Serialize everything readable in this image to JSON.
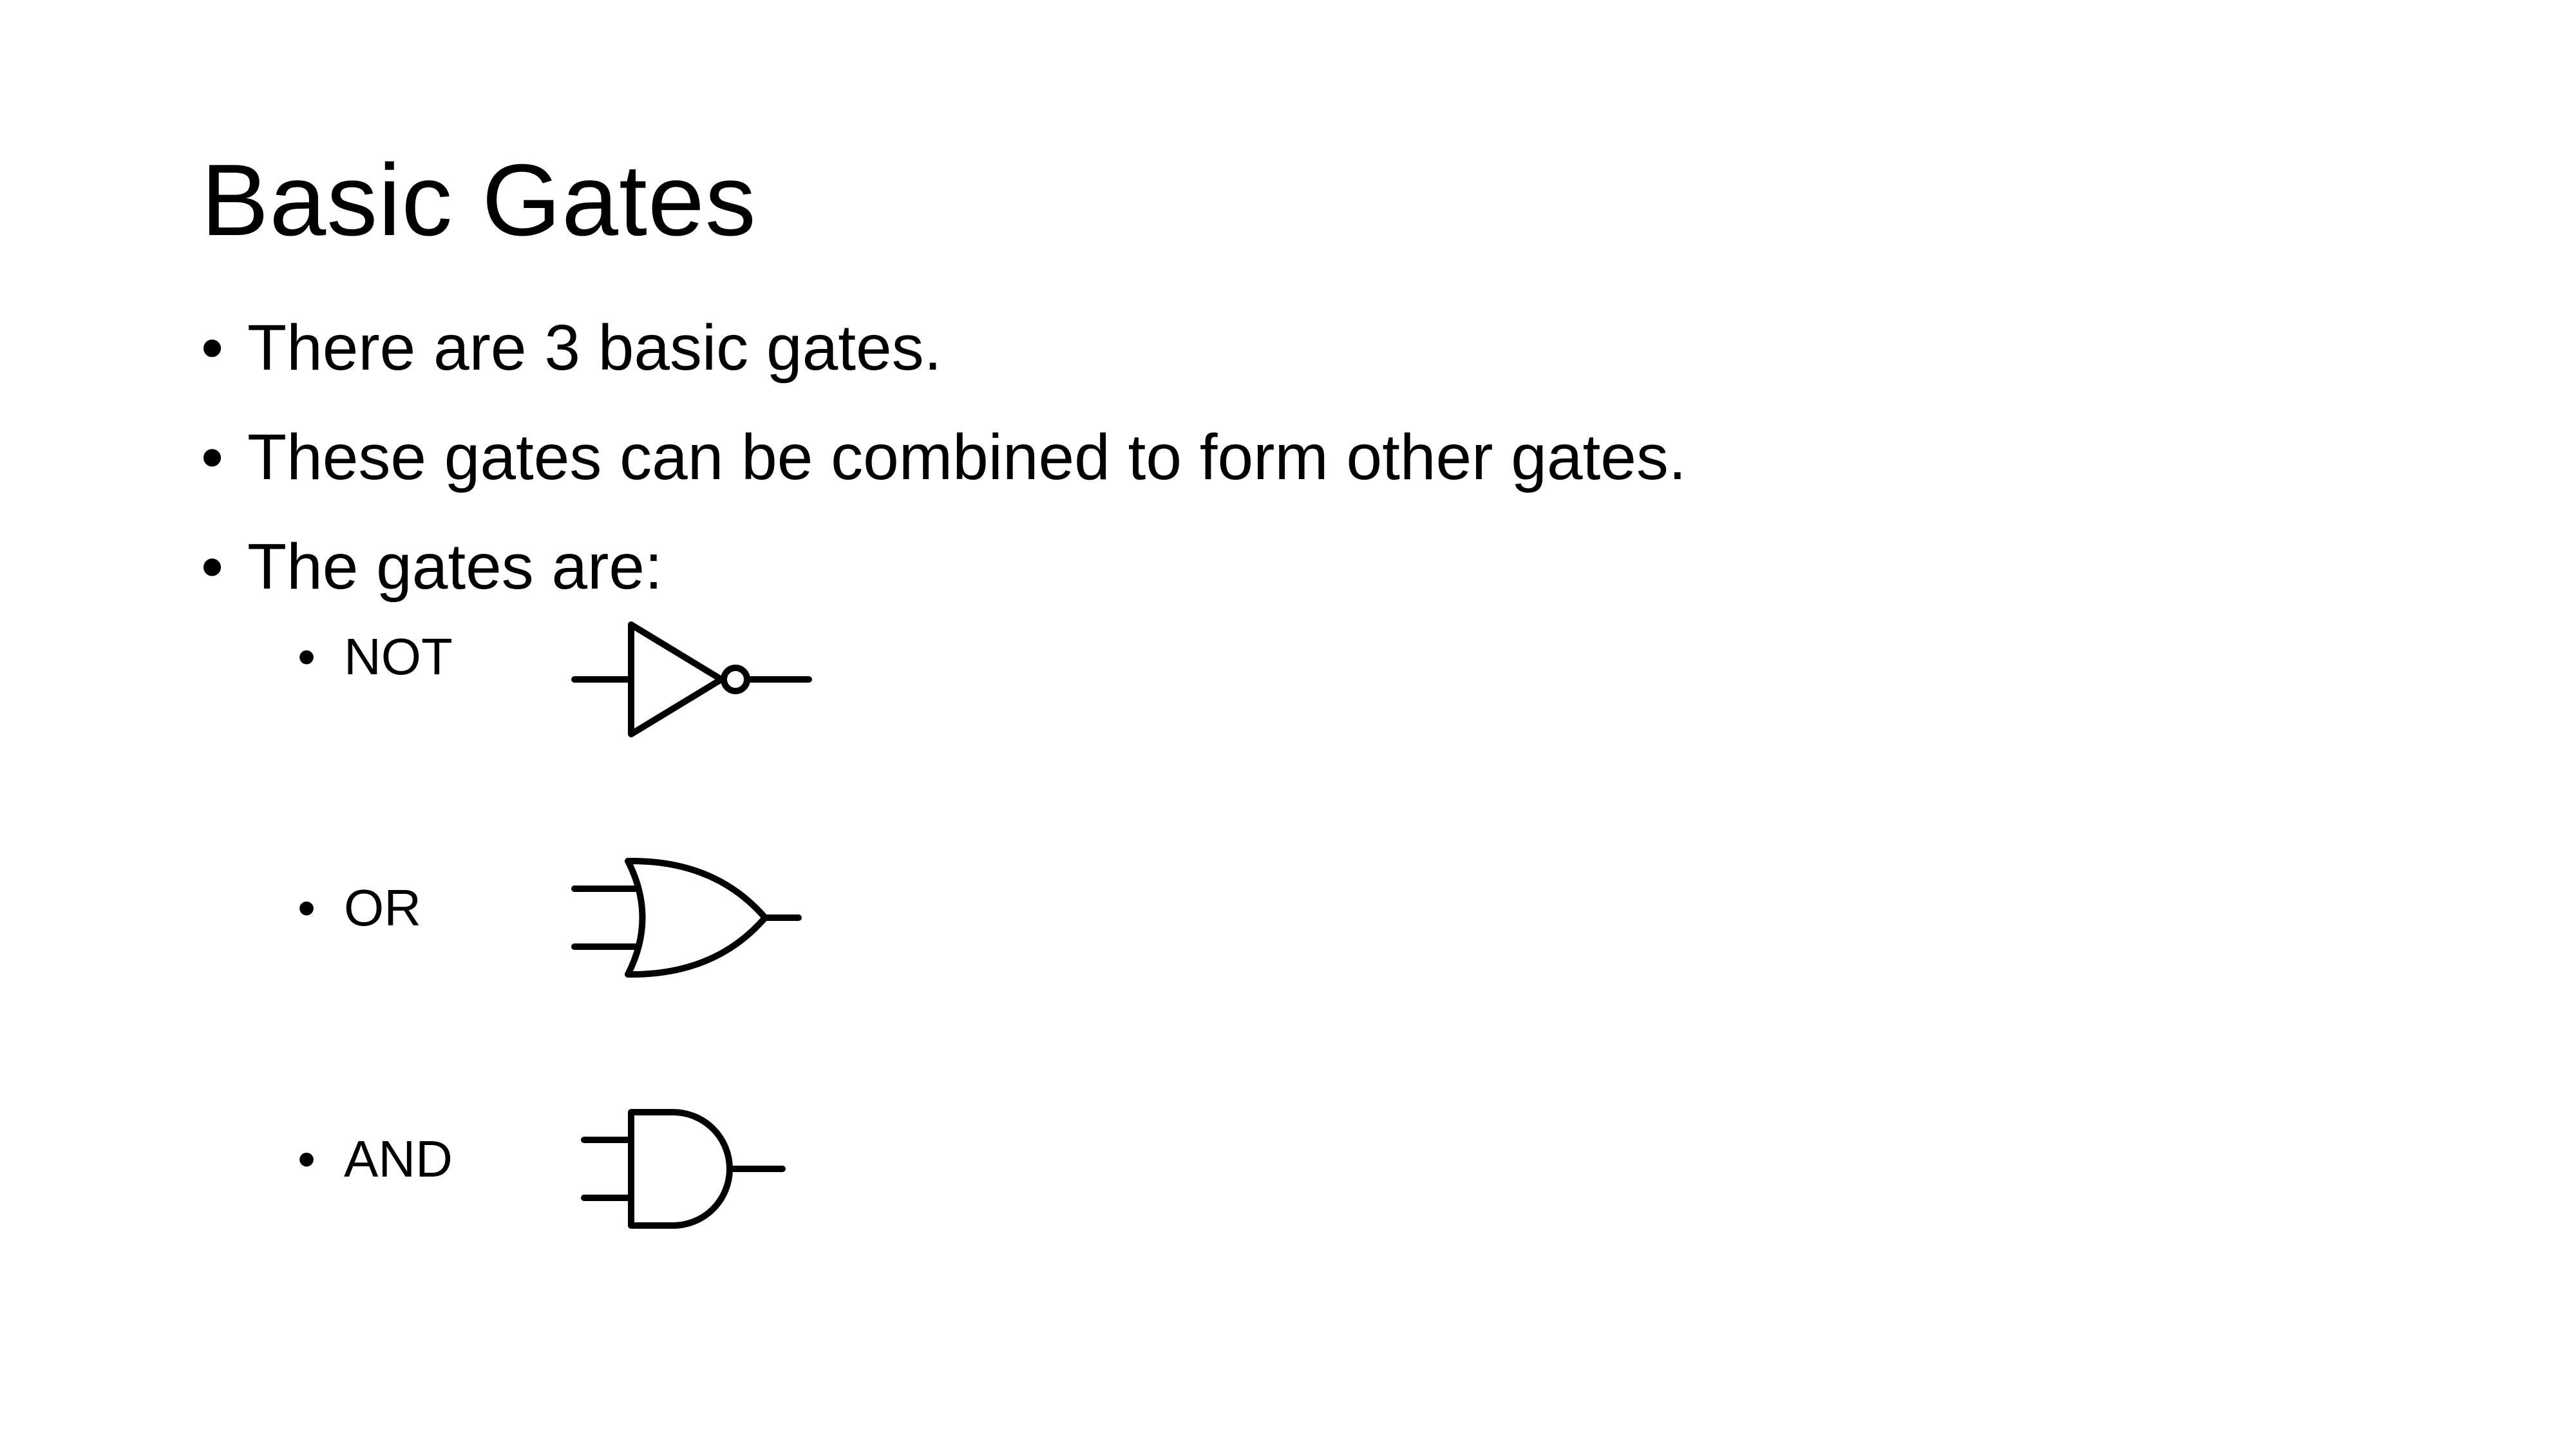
{
  "slide": {
    "title": "Basic Gates",
    "bullets": [
      "There are 3 basic gates.",
      "These gates can be combined to form other gates.",
      "The gates are:"
    ],
    "bullet_symbol": "•",
    "gates": [
      {
        "label": "NOT",
        "icon": "not-gate-icon"
      },
      {
        "label": "OR",
        "icon": "or-gate-icon"
      },
      {
        "label": "AND",
        "icon": "and-gate-icon"
      }
    ]
  }
}
